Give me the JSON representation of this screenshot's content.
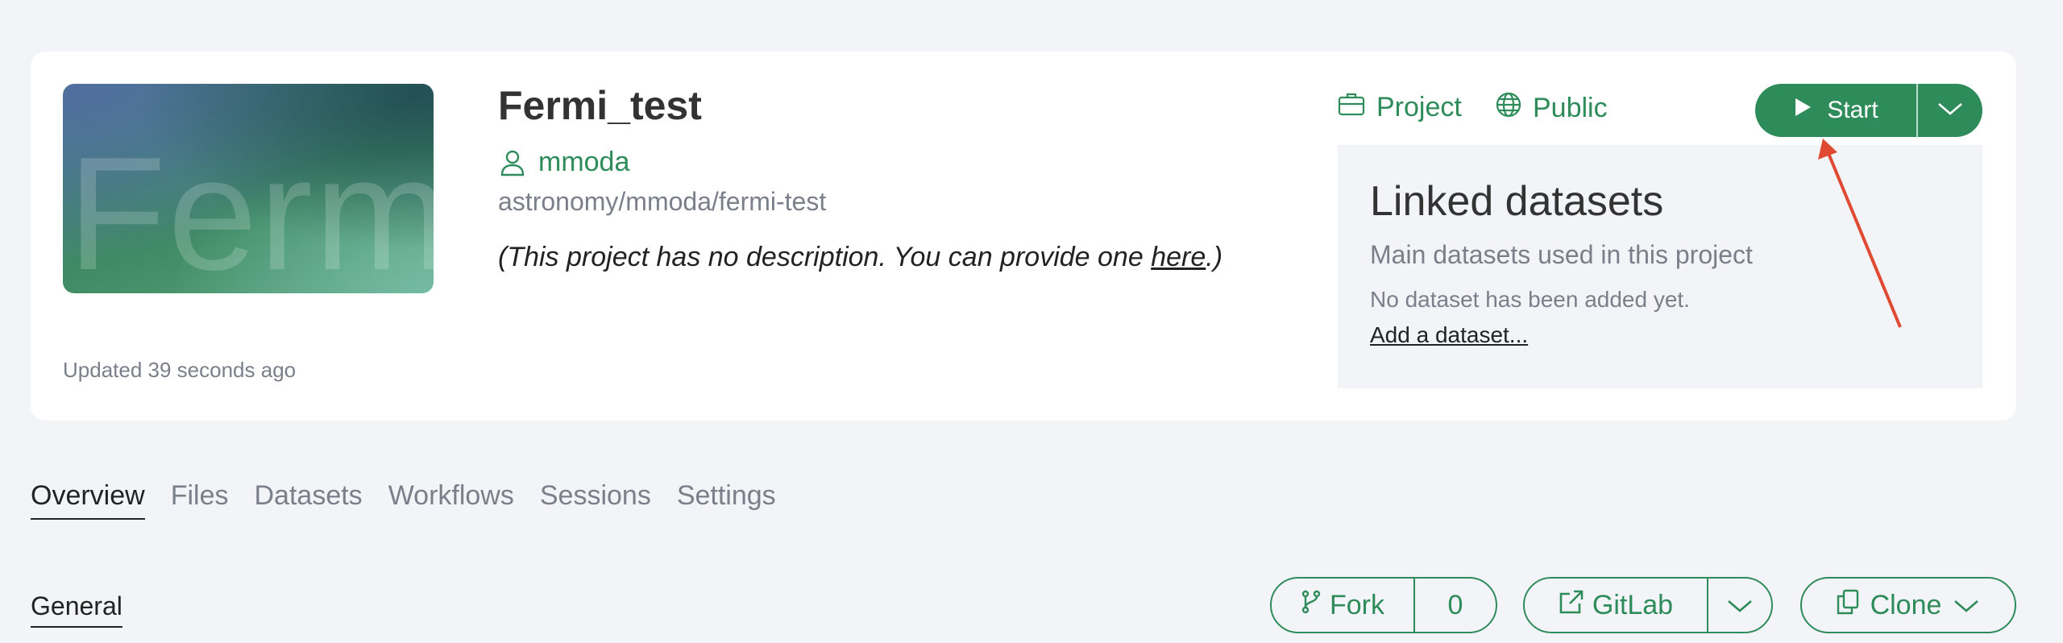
{
  "project": {
    "title": "Fermi_test",
    "thumbnail_text": "Ferm",
    "owner": "mmoda",
    "path": "astronomy/mmoda/fermi-test",
    "description_prefix": "(This project has no description. You can provide one ",
    "description_link": "here",
    "description_suffix": ".)",
    "updated": "Updated 39 seconds ago",
    "type_label": "Project",
    "visibility_label": "Public"
  },
  "actions": {
    "start_label": "Start",
    "fork_label": "Fork",
    "fork_count": "0",
    "gitlab_label": "GitLab",
    "clone_label": "Clone"
  },
  "datasets": {
    "title": "Linked datasets",
    "subtitle": "Main datasets used in this project",
    "empty": "No dataset has been added yet.",
    "add_link": "Add a dataset..."
  },
  "tabs": [
    "Overview",
    "Files",
    "Datasets",
    "Workflows",
    "Sessions",
    "Settings"
  ],
  "section": {
    "general": "General"
  },
  "colors": {
    "accent": "#2e8b5a",
    "annotation": "#e04a32"
  }
}
